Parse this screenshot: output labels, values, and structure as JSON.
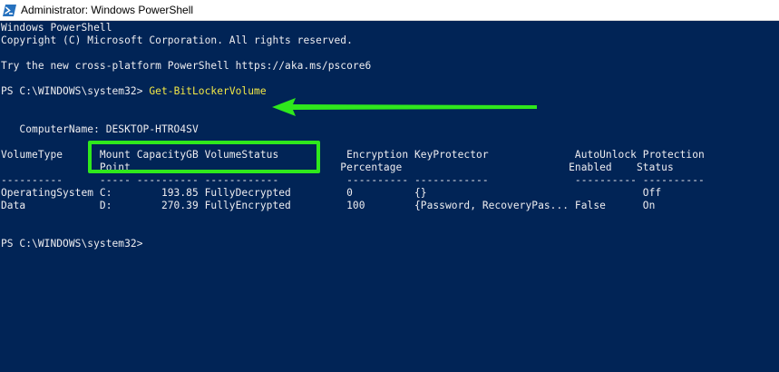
{
  "window": {
    "title": "Administrator: Windows PowerShell",
    "logo_icon": "powershell-icon",
    "background": "#012456",
    "text_color": "#eeedf0",
    "command_color": "#f3e946",
    "annotation_color": "#2fe81c"
  },
  "console": {
    "header_line1": "Windows PowerShell",
    "header_line2": "Copyright (C) Microsoft Corporation. All rights reserved.",
    "header_line3": "Try the new cross-platform PowerShell https://aka.ms/pscore6",
    "prompt1": "PS C:\\WINDOWS\\system32> ",
    "command": "Get-BitLockerVolume",
    "computer_name_line": "   ComputerName: DESKTOP-HTRO4SV",
    "table": {
      "header_row1": "VolumeType      Mount CapacityGB VolumeStatus           Encryption KeyProtector              AutoUnlock Protection",
      "header_row2": "                Point                                  Percentage                           Enabled    Status",
      "separator_row": "----------      ----- ---------- ------------           ---------- ------------              ---------- ----------",
      "rows": [
        "OperatingSystem C:        193.85 FullyDecrypted         0          {}                                   Off",
        "Data            D:        270.39 FullyEncrypted         100        {Password, RecoveryPas... False      On"
      ]
    },
    "prompt2": "PS C:\\WINDOWS\\system32> "
  },
  "annotations": {
    "arrow_icon": "left-arrow-icon",
    "highlight": "highlight-box"
  }
}
